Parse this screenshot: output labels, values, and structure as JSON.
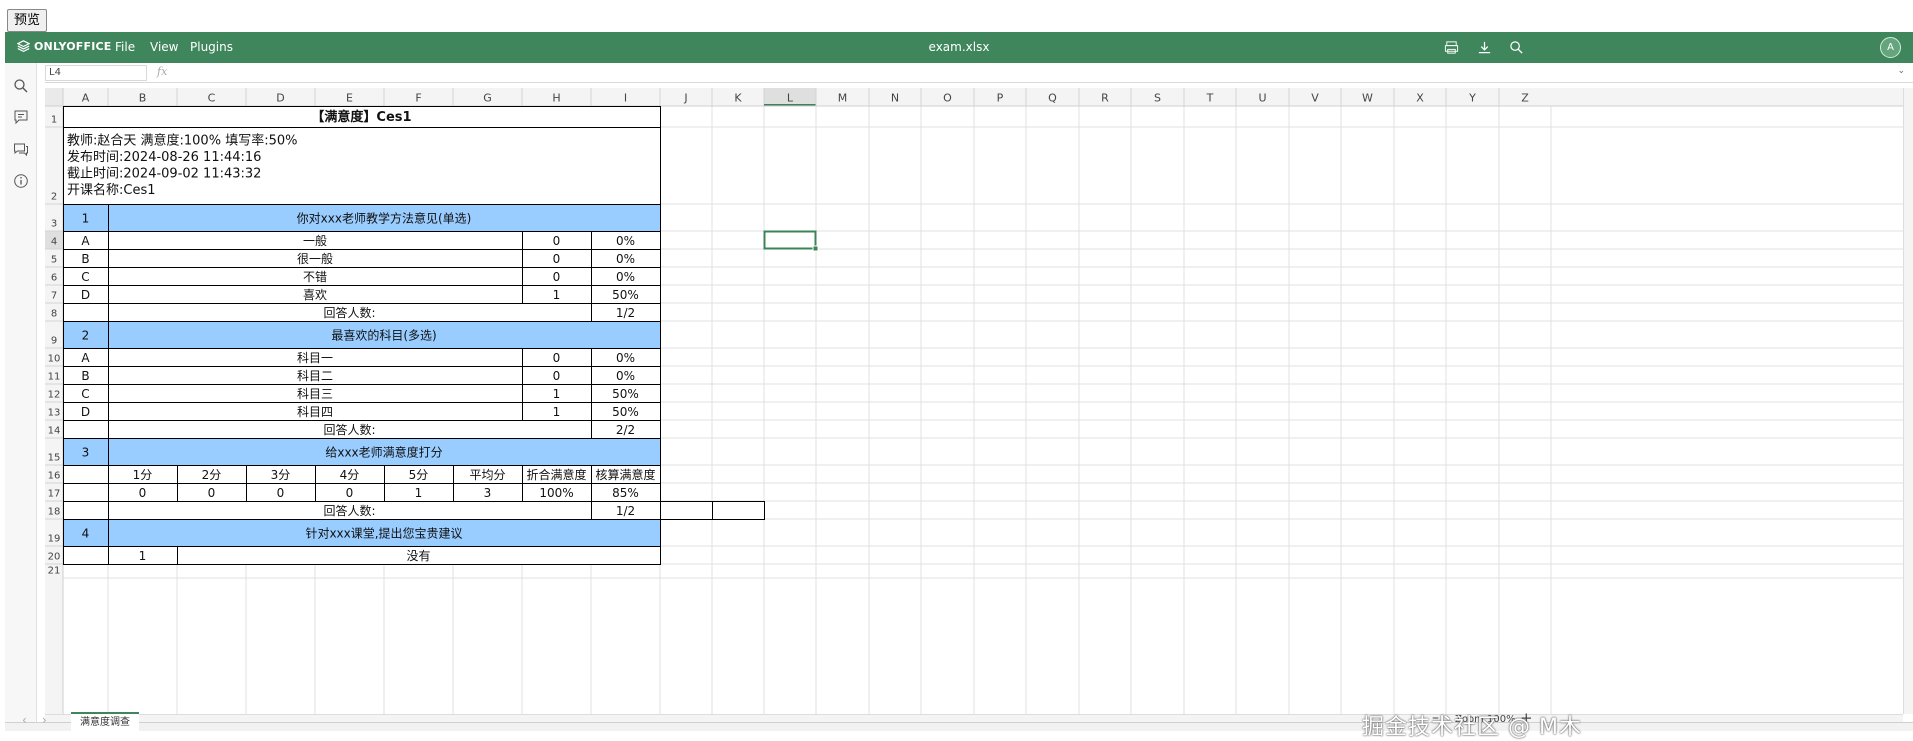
{
  "preview_button": "预览",
  "app": {
    "brand": "ONLYOFFICE",
    "menus": [
      "File",
      "View",
      "Plugins"
    ],
    "doc_title": "exam.xlsx",
    "avatar": "A"
  },
  "formula": {
    "name_box": "L4",
    "fx": "fx",
    "value": ""
  },
  "columns": [
    "A",
    "B",
    "C",
    "D",
    "E",
    "F",
    "G",
    "H",
    "I",
    "J",
    "K",
    "L",
    "M",
    "N",
    "O",
    "P",
    "Q",
    "R",
    "S",
    "T",
    "U",
    "V",
    "W",
    "X",
    "Y",
    "Z"
  ],
  "rows": [
    "1",
    "2",
    "3",
    "4",
    "5",
    "6",
    "7",
    "8",
    "9",
    "10",
    "11",
    "12",
    "13",
    "14",
    "15",
    "16",
    "17",
    "18",
    "19",
    "20",
    "21"
  ],
  "selected": {
    "col": "L",
    "row": "4"
  },
  "sheet": {
    "title": "【满意度】Ces1",
    "info": [
      "教师:赵合天    满意度:100%    填写率:50%",
      "发布时间:2024-08-26 11:44:16",
      "截止时间:2024-09-02 11:43:32",
      "开课名称:Ces1"
    ],
    "q1": {
      "no": "1",
      "title": "你对xxx老师教学方法意见(单选)",
      "options": [
        {
          "key": "A",
          "text": "一般",
          "count": "0",
          "pct": "0%"
        },
        {
          "key": "B",
          "text": "很一般",
          "count": "0",
          "pct": "0%"
        },
        {
          "key": "C",
          "text": "不错",
          "count": "0",
          "pct": "0%"
        },
        {
          "key": "D",
          "text": "喜欢",
          "count": "1",
          "pct": "50%"
        }
      ],
      "answer_label": "回答人数:",
      "answer_value": "1/2"
    },
    "q2": {
      "no": "2",
      "title": "最喜欢的科目(多选)",
      "options": [
        {
          "key": "A",
          "text": "科目一",
          "count": "0",
          "pct": "0%"
        },
        {
          "key": "B",
          "text": "科目二",
          "count": "0",
          "pct": "0%"
        },
        {
          "key": "C",
          "text": "科目三",
          "count": "1",
          "pct": "50%"
        },
        {
          "key": "D",
          "text": "科目四",
          "count": "1",
          "pct": "50%"
        }
      ],
      "answer_label": "回答人数:",
      "answer_value": "2/2"
    },
    "q3": {
      "no": "3",
      "title": "给xxx老师满意度打分",
      "headers": [
        "1分",
        "2分",
        "3分",
        "4分",
        "5分",
        "平均分",
        "折合满意度",
        "核算满意度"
      ],
      "values": [
        "0",
        "0",
        "0",
        "0",
        "1",
        "3",
        "100%",
        "85%"
      ],
      "answer_label": "回答人数:",
      "answer_value": "1/2"
    },
    "q4": {
      "no": "4",
      "title": "针对xxx课堂,提出您宝贵建议",
      "index": "1",
      "answer": "没有"
    }
  },
  "sheet_tab": "满意度调查",
  "zoom": "Zoom 100%",
  "watermark": "掘金技术社区 @ M木",
  "colors": {
    "brand": "#40865c",
    "header_fill": "#99ccff",
    "grid": "#e1e1e1",
    "selection": "#3c8358"
  }
}
